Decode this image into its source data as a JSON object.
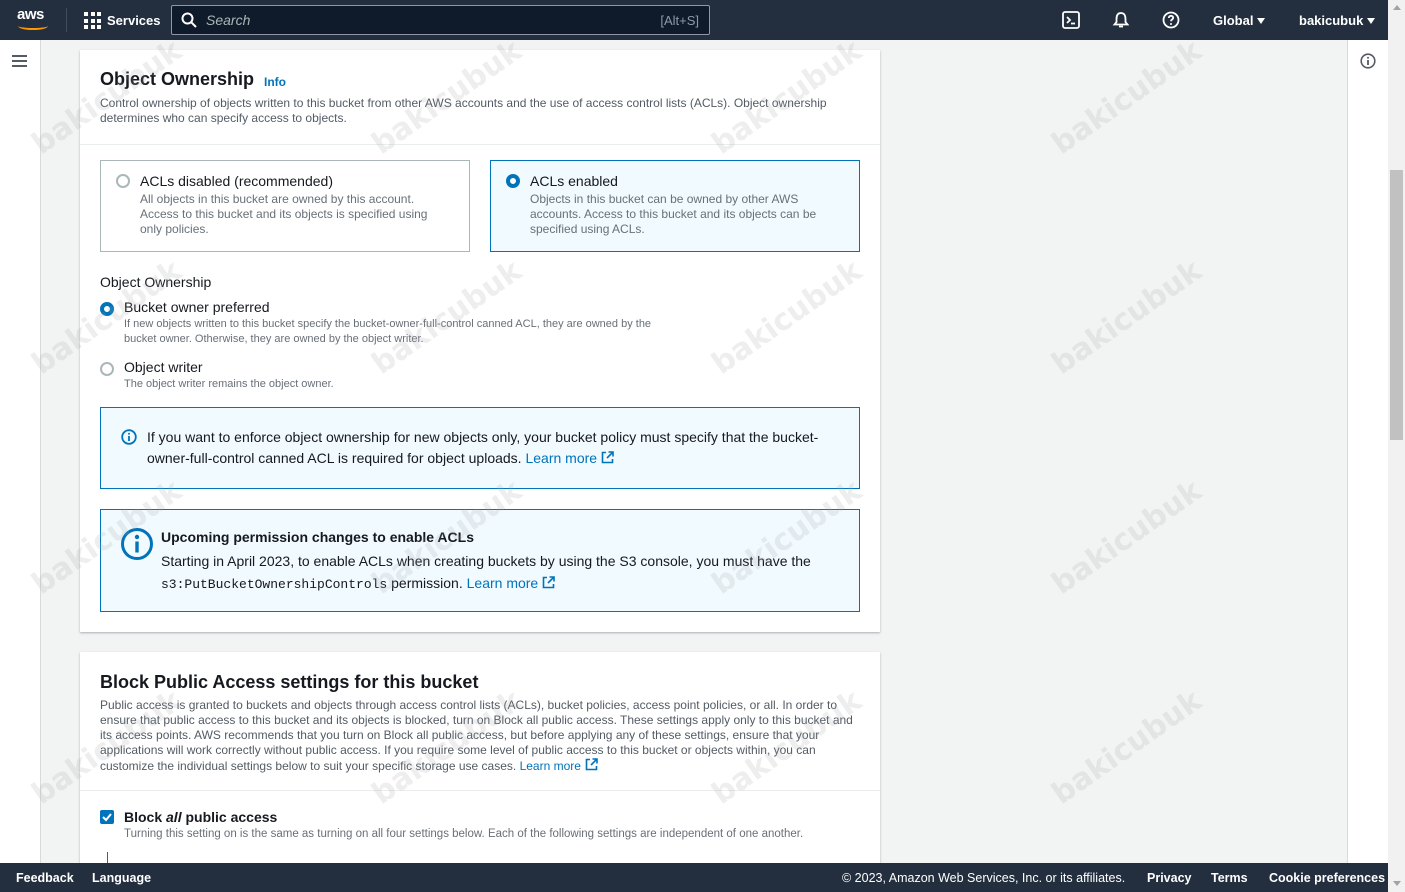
{
  "topnav": {
    "logo_text": "aws",
    "services_label": "Services",
    "search_placeholder": "Search",
    "search_shortcut": "[Alt+S]",
    "region_label": "Global",
    "user_label": "bakicubuk"
  },
  "object_ownership": {
    "title": "Object Ownership",
    "info_label": "Info",
    "description": "Control ownership of objects written to this bucket from other AWS accounts and the use of access control lists (ACLs). Object ownership determines who can specify access to objects.",
    "tiles": [
      {
        "label": "ACLs disabled (recommended)",
        "description": "All objects in this bucket are owned by this account. Access to this bucket and its objects is specified using only policies.",
        "selected": false
      },
      {
        "label": "ACLs enabled",
        "description": "Objects in this bucket can be owned by other AWS accounts. Access to this bucket and its objects can be specified using ACLs.",
        "selected": true
      }
    ],
    "ownership_field_label": "Object Ownership",
    "options": [
      {
        "label": "Bucket owner preferred",
        "description": "If new objects written to this bucket specify the bucket-owner-full-control canned ACL, they are owned by the bucket owner. Otherwise, they are owned by the object writer.",
        "selected": true
      },
      {
        "label": "Object writer",
        "description": "The object writer remains the object owner.",
        "selected": false
      }
    ],
    "alert_info": {
      "text": "If you want to enforce object ownership for new objects only, your bucket policy must specify that the bucket-owner-full-control canned ACL is required for object uploads.",
      "link": "Learn more"
    },
    "alert_upcoming": {
      "title": "Upcoming permission changes to enable ACLs",
      "text_before": "Starting in April 2023, to enable ACLs when creating buckets by using the S3 console, you must have the",
      "code": "s3:PutBucketOwnershipControls",
      "text_after": "permission.",
      "link": "Learn more"
    }
  },
  "block_public_access": {
    "title": "Block Public Access settings for this bucket",
    "description": "Public access is granted to buckets and objects through access control lists (ACLs), bucket policies, access point policies, or all. In order to ensure that public access to this bucket and its objects is blocked, turn on Block all public access. These settings apply only to this bucket and its access points. AWS recommends that you turn on Block all public access, but before applying any of these settings, ensure that your applications will work correctly without public access. If you require some level of public access to this bucket or objects within, you can customize the individual settings below to suit your specific storage use cases.",
    "link": "Learn more",
    "checkbox_label_pre": "Block ",
    "checkbox_label_em": "all",
    "checkbox_label_post": " public access",
    "checkbox_checked": true,
    "checkbox_description": "Turning this setting on is the same as turning on all four settings below. Each of the following settings are independent of one another."
  },
  "footer": {
    "feedback": "Feedback",
    "language": "Language",
    "copyright": "© 2023, Amazon Web Services, Inc. or its affiliates.",
    "privacy": "Privacy",
    "terms": "Terms",
    "cookies": "Cookie preferences"
  },
  "watermark_text": "bakicubuk",
  "colors": {
    "nav_bg": "#232f3e",
    "link": "#0073bb",
    "selected_bg": "#f1faff",
    "brand_orange": "#ff9900"
  }
}
